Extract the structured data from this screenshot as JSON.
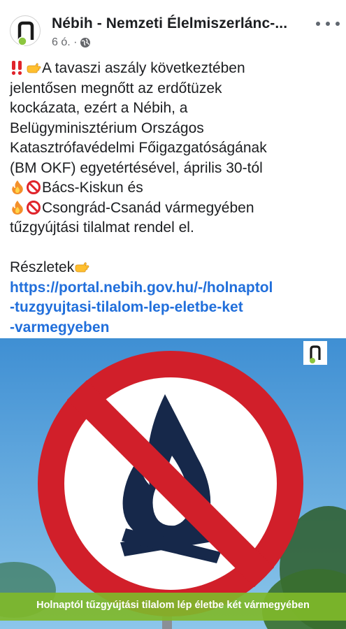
{
  "header": {
    "page_name": "Nébih - Nemzeti Élelmiszerlánc-...",
    "time": "6 ó. ·",
    "more_label": "..."
  },
  "post": {
    "lines": [
      "A tavaszi aszály következtében",
      "jelentősen megnőtt az erdőtüzek",
      "kockázata, ezért a Nébih, a",
      "Belügyminisztérium Országos",
      "Katasztrófavédelmi Főigazgatóságának",
      "(BM OKF) egyetértésével, április 30-tól",
      "Bács-Kiskun és",
      "Csongrád-Csanád vármegyében",
      "tűzgyújtási tilalmat rendel el.",
      "Részletek"
    ],
    "link_lines": [
      "https://portal.nebih.gov.hu/-/holnaptol",
      "-tuzgyujtasi-tilalom-lep-eletbe-ket",
      "-varmegyeben"
    ]
  },
  "image": {
    "banner": "Holnaptól tűzgyújtási tilalom lép életbe két vármegyében"
  },
  "colors": {
    "link": "#216fdb",
    "banner": "#7fb92a",
    "sign_red": "#d11f2a",
    "flame": "#16284a",
    "sky": "#5aa5d8"
  },
  "icons": {
    "exclamation": "double-exclamation-icon",
    "point": "pointing-hand-icon",
    "fire": "fire-icon",
    "prohibited": "prohibited-icon",
    "globe": "globe-icon"
  }
}
